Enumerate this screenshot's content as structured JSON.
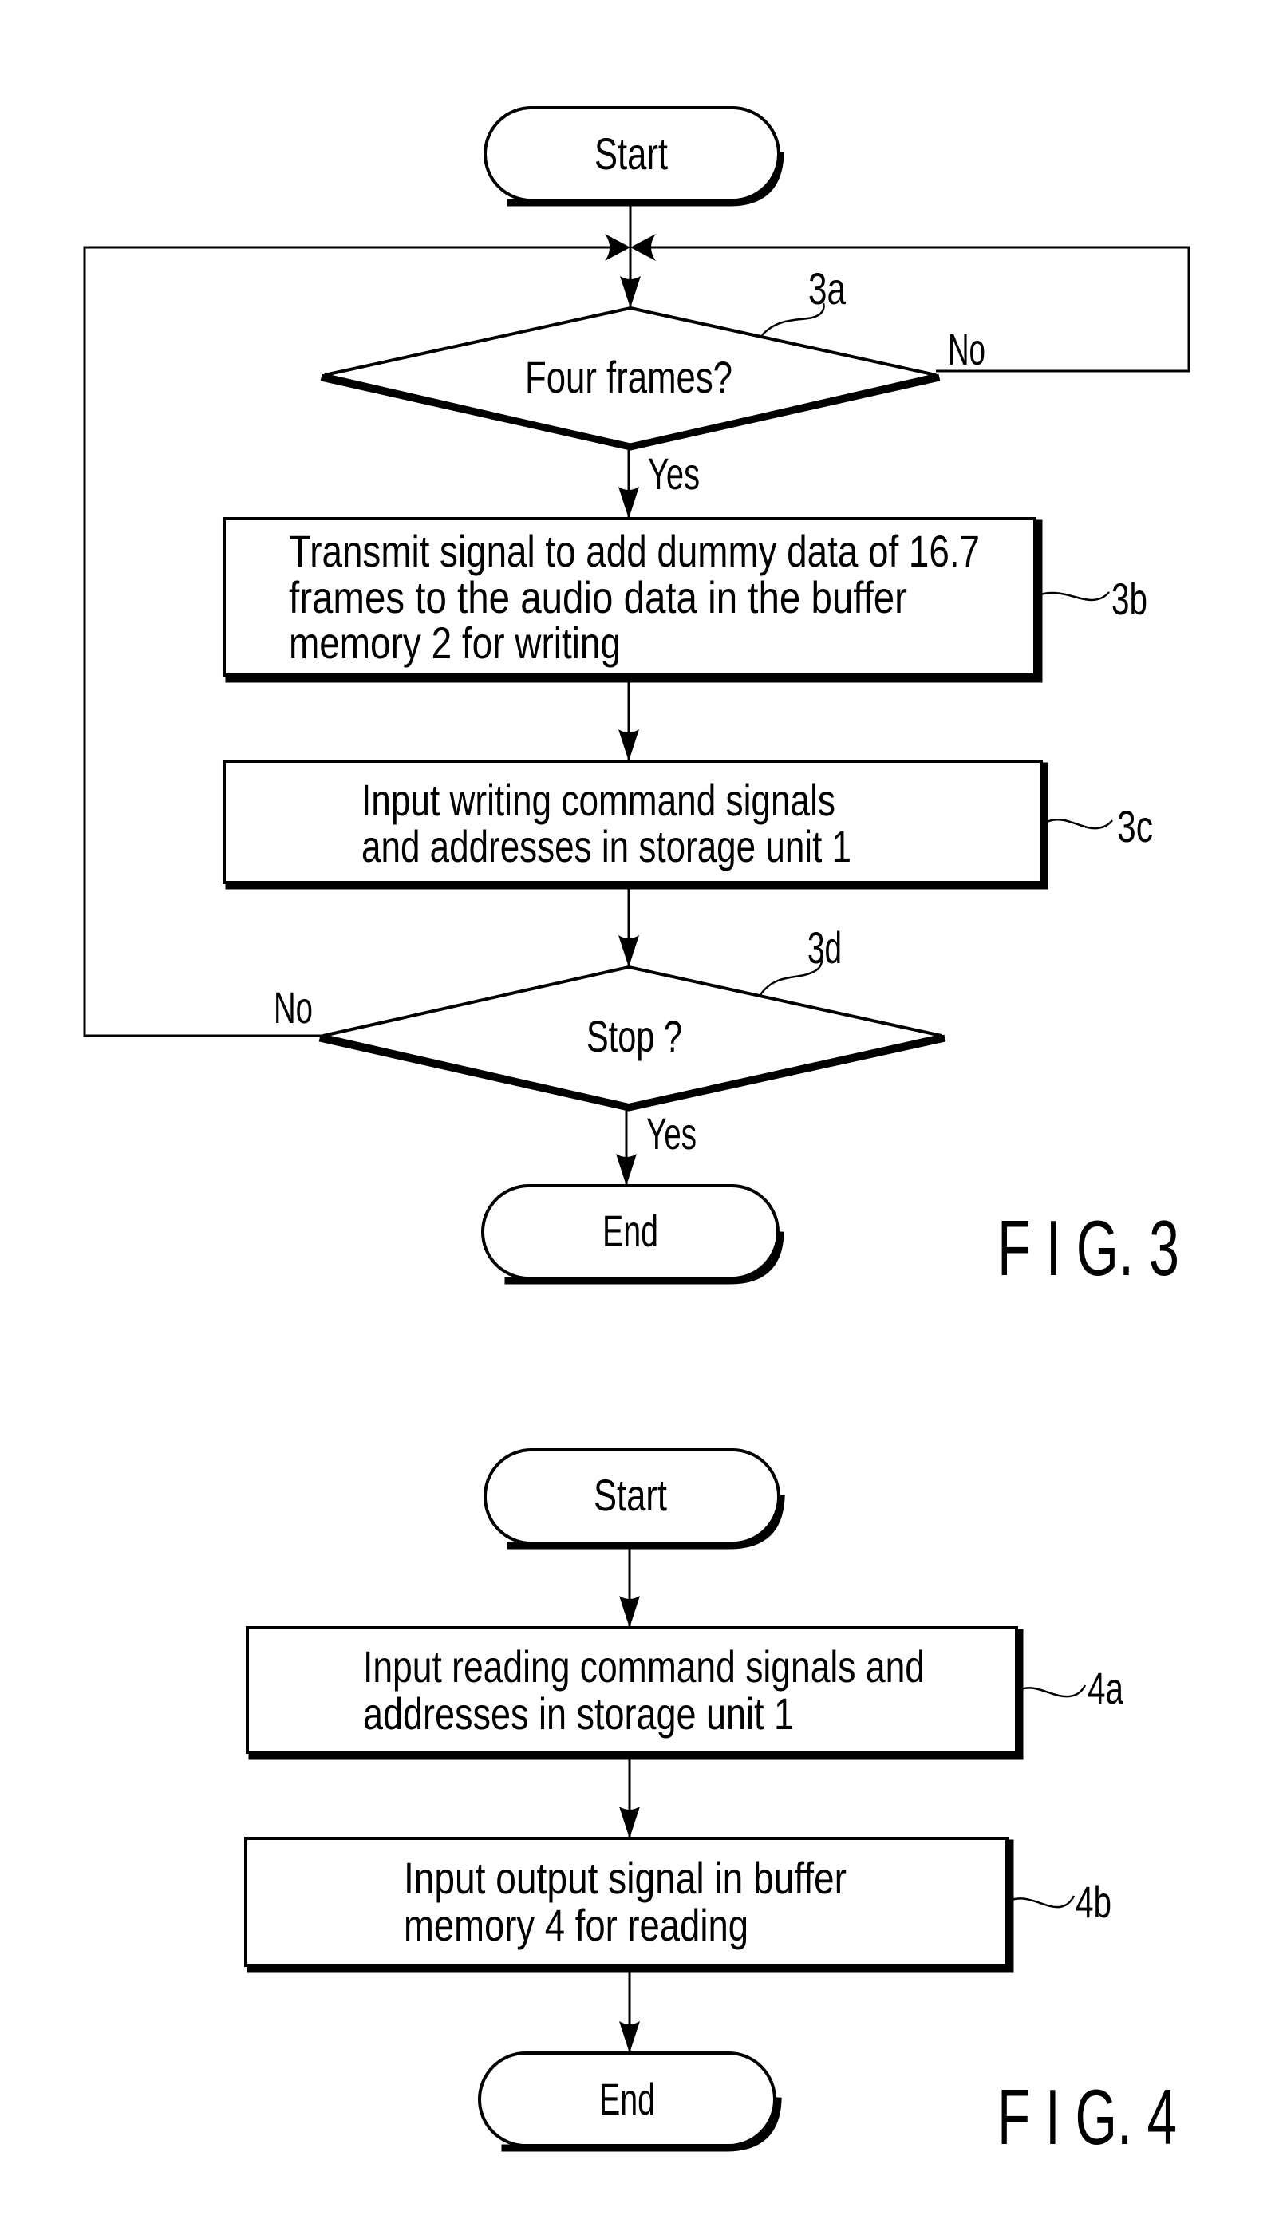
{
  "figures": [
    {
      "id": "fig3",
      "caption": "F I G. 3",
      "start_label": "Start",
      "end_label": "End",
      "steps": [
        {
          "ref": "3a",
          "type": "decision",
          "text": "Four frames?",
          "yes_label": "Yes",
          "no_label": "No"
        },
        {
          "ref": "3b",
          "type": "process",
          "lines": [
            "Transmit signal to add dummy data of 16.7",
            "frames to the audio data in the buffer",
            "memory 2 for writing"
          ]
        },
        {
          "ref": "3c",
          "type": "process",
          "lines": [
            "Input writing command signals",
            "and addresses in storage unit 1"
          ]
        },
        {
          "ref": "3d",
          "type": "decision",
          "text": "Stop ?",
          "yes_label": "Yes",
          "no_label": "No"
        }
      ]
    },
    {
      "id": "fig4",
      "caption": "F I G. 4",
      "start_label": "Start",
      "end_label": "End",
      "steps": [
        {
          "ref": "4a",
          "type": "process",
          "lines": [
            "Input reading command signals and",
            "addresses in storage unit 1"
          ]
        },
        {
          "ref": "4b",
          "type": "process",
          "lines": [
            "Input output signal in buffer",
            "memory 4 for reading"
          ]
        }
      ]
    }
  ],
  "colors": {
    "ink": "#000000",
    "paper": "#ffffff"
  }
}
